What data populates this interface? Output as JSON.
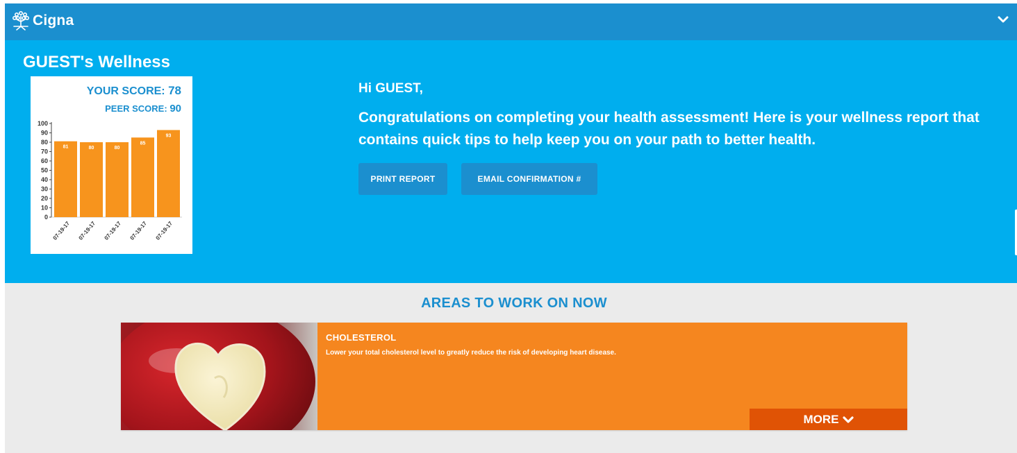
{
  "header": {
    "brand": "Cigna",
    "logo_icon": "tree-person-icon",
    "menu_icon": "chevron-down-icon"
  },
  "hero": {
    "title": "GUEST's Wellness",
    "your_score_label": "YOUR SCORE:",
    "your_score_value": "78",
    "peer_score_label": "PEER SCORE:",
    "peer_score_value": "90",
    "greeting": "Hi GUEST,",
    "message": "Congratulations on completing your health assessment! Here is your wellness report that contains quick tips to help keep you on your path to better health.",
    "print_label": "PRINT REPORT",
    "email_label": "EMAIL CONFIRMATION #"
  },
  "chart_data": {
    "type": "bar",
    "categories": [
      "07-19-17",
      "07-19-17",
      "07-19-17",
      "07-19-17",
      "07-19-17"
    ],
    "values": [
      81,
      80,
      80,
      85,
      93
    ],
    "ylim": [
      0,
      100
    ],
    "yticks": [
      0,
      10,
      20,
      30,
      40,
      50,
      60,
      70,
      80,
      90,
      100
    ],
    "bar_color": "#f7941d",
    "grid": false
  },
  "areas": {
    "title": "AREAS TO WORK ON NOW",
    "cards": [
      {
        "title": "CHOLESTEROL",
        "description": "Lower your total cholesterol level to greatly reduce the risk of developing heart disease.",
        "more_label": "MORE",
        "image": "apple-heart-image"
      }
    ]
  },
  "colors": {
    "topbar": "#1b8fcf",
    "hero": "#00aeee",
    "accent_orange": "#f5861f",
    "more_orange": "#e05305",
    "background": "#ebebeb"
  }
}
